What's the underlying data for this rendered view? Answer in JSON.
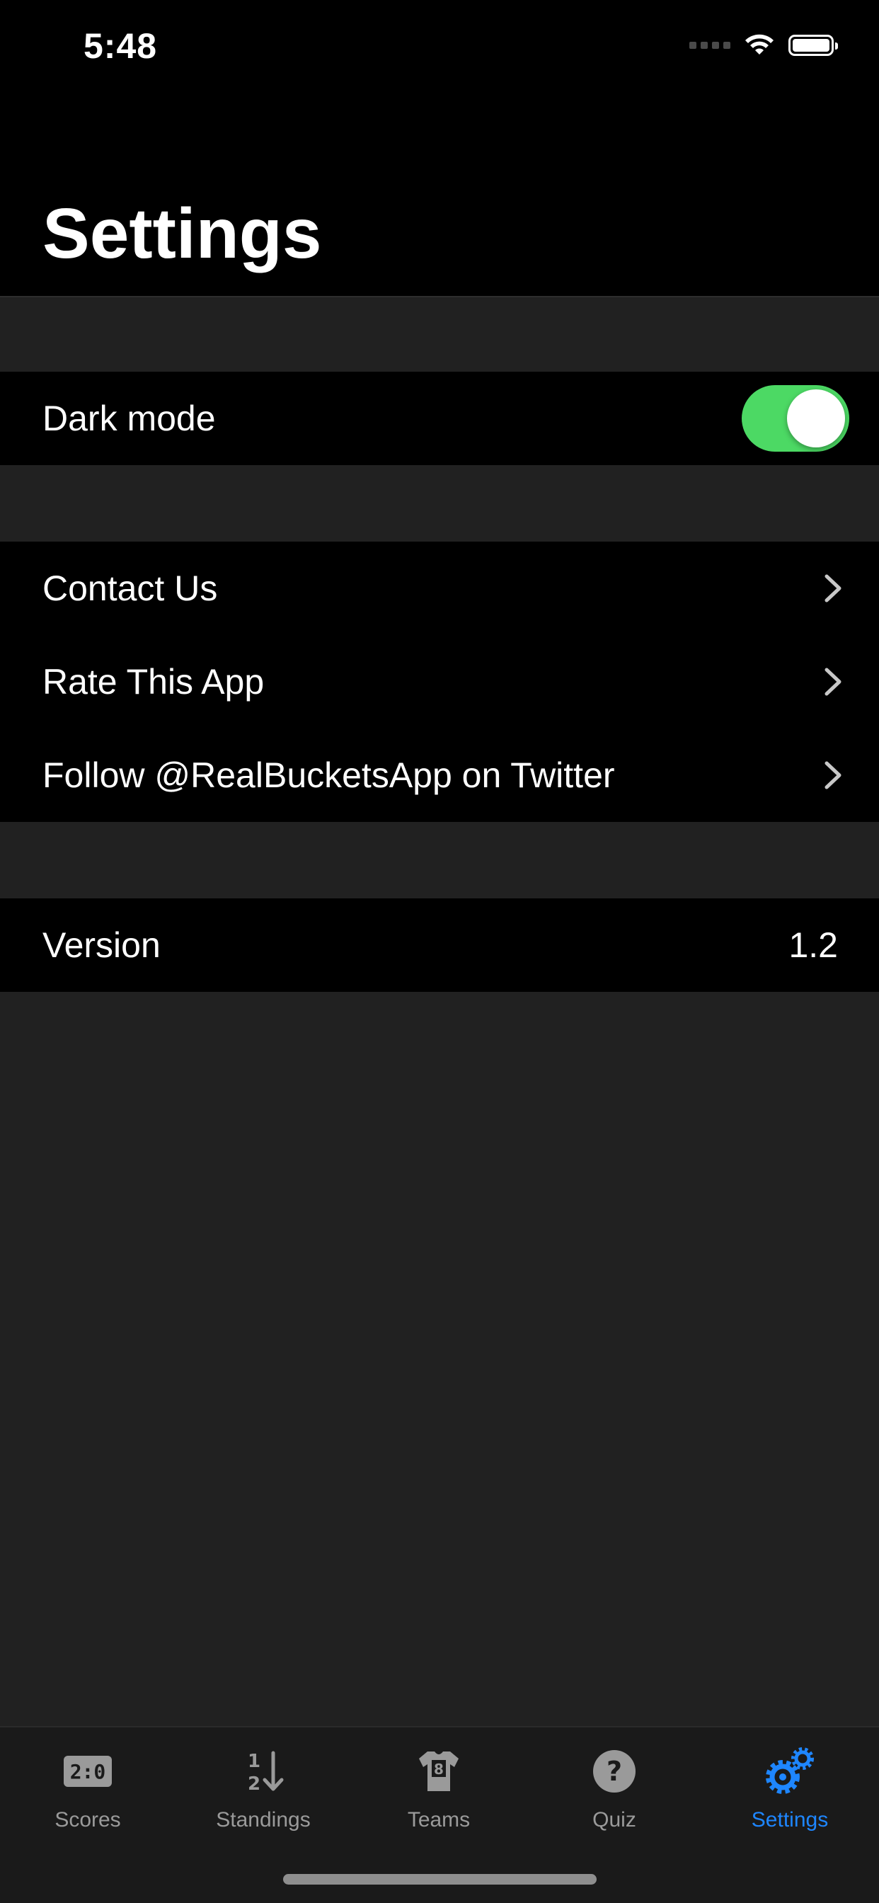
{
  "status_bar": {
    "time": "5:48"
  },
  "header": {
    "title": "Settings"
  },
  "sections": {
    "appearance": {
      "dark_mode_label": "Dark mode",
      "dark_mode_on": true
    },
    "links": [
      {
        "label": "Contact Us"
      },
      {
        "label": "Rate This App"
      },
      {
        "label": "Follow @RealBucketsApp on Twitter"
      }
    ],
    "info": {
      "version_label": "Version",
      "version_value": "1.2"
    }
  },
  "tabbar": {
    "items": [
      {
        "label": "Scores",
        "icon": "scoreboard-icon"
      },
      {
        "label": "Standings",
        "icon": "standings-icon"
      },
      {
        "label": "Teams",
        "icon": "jersey-icon"
      },
      {
        "label": "Quiz",
        "icon": "question-icon"
      },
      {
        "label": "Settings",
        "icon": "gears-icon",
        "active": true
      }
    ]
  },
  "colors": {
    "accent": "#1e86ff",
    "toggle_on": "#4cd964",
    "background": "#212121",
    "cell": "#000000"
  }
}
